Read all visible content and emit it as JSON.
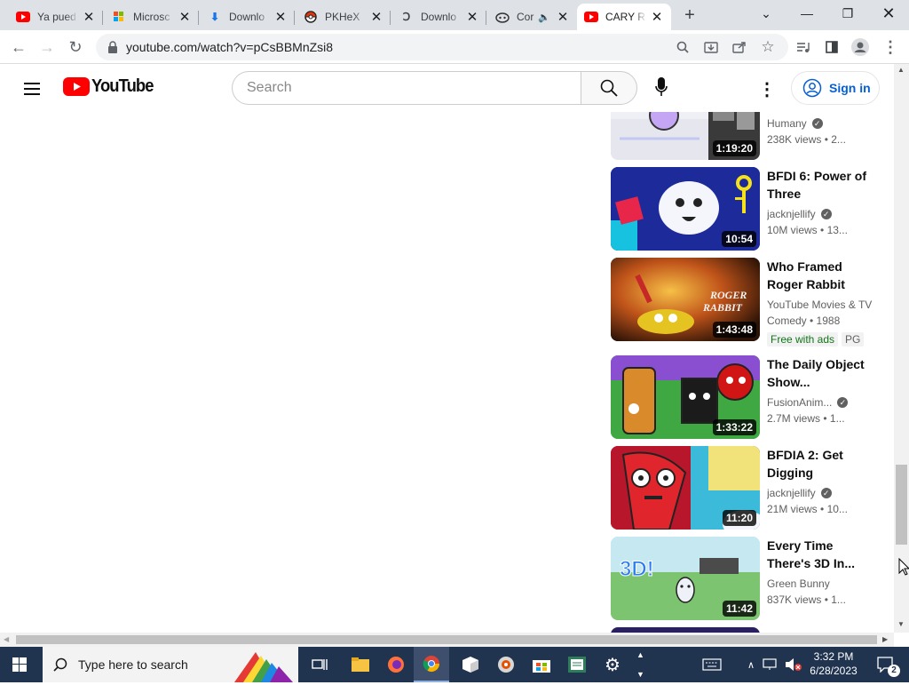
{
  "browser": {
    "tabs": [
      {
        "title": "Ya pued",
        "icon": "youtube-icon"
      },
      {
        "title": "Microsc",
        "icon": "microsoft-icon"
      },
      {
        "title": "Downlo",
        "icon": "download-icon"
      },
      {
        "title": "PKHeX",
        "icon": "pokeball-icon"
      },
      {
        "title": "Downlo",
        "icon": "download-site-icon"
      },
      {
        "title": "Cor",
        "icon": "discord-icon"
      },
      {
        "title": "CARY R",
        "icon": "youtube-icon"
      }
    ],
    "new_tab": "+",
    "url": "youtube.com/watch?v=pCsBBMnZsi8"
  },
  "youtube": {
    "logo_text": "YouTube",
    "search_placeholder": "Search",
    "sign_in": "Sign in"
  },
  "videos": [
    {
      "title": "",
      "channel": "Humany",
      "verified": true,
      "views": "238K views",
      "age": "2...",
      "duration": "1:19:20"
    },
    {
      "title": "BFDI 6: Power of Three",
      "channel": "jacknjellify",
      "verified": true,
      "views": "10M views",
      "age": "13...",
      "duration": "10:54"
    },
    {
      "title": "Who Framed Roger Rabbit",
      "channel": "YouTube Movies & TV",
      "verified": false,
      "views": "Comedy • 1988",
      "age": "",
      "duration": "1:43:48",
      "badge_green": "Free with ads",
      "badge": "PG"
    },
    {
      "title": "The Daily Object Show...",
      "channel": "FusionAnim...",
      "verified": true,
      "views": "2.7M views",
      "age": "1...",
      "duration": "1:33:22"
    },
    {
      "title": "BFDIA 2: Get Digging",
      "channel": "jacknjellify",
      "verified": true,
      "views": "21M views",
      "age": "10...",
      "duration": "11:20"
    },
    {
      "title": "Every Time There's 3D In...",
      "channel": "Green Bunny",
      "verified": false,
      "views": "837K views",
      "age": "1...",
      "duration": "11:42"
    }
  ],
  "taskbar": {
    "search_placeholder": "Type here to search",
    "time": "3:32 PM",
    "date": "6/28/2023",
    "notification_count": "2"
  },
  "colors": {
    "youtube_red": "#ff0000",
    "link_blue": "#065fd4",
    "free_green": "#107516",
    "taskbar": "#20334f"
  }
}
